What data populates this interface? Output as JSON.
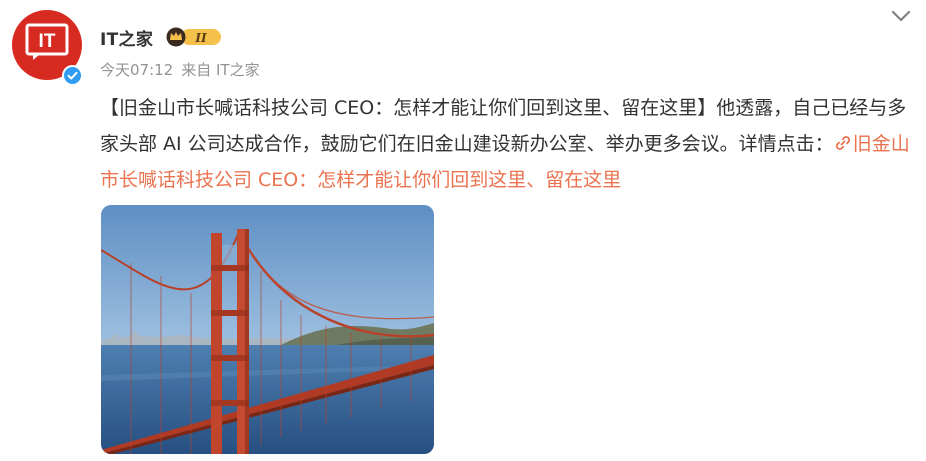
{
  "post": {
    "author": {
      "name": "IT之家",
      "avatar_text": "IT",
      "badge_text": "II"
    },
    "timestamp": "今天07:12",
    "source": "来自 IT之家",
    "text_intro": "【旧金山市长喊话科技公司 CEO：怎样才能让你们回到这里、留在这里】他透露，自己已经与多家头部 AI 公司达成合作，鼓励它们在旧金山建设新办公室、举办更多会议。详情点击：",
    "link_text": "旧金山市长喊话科技公司 CEO：怎样才能让你们回到这里、留在这里",
    "image": {
      "subject": "golden-gate-bridge-photo"
    }
  },
  "colors": {
    "brand_red": "#d72b21",
    "link_orange": "#eb7350",
    "verified_blue": "#2f9df4",
    "meta_gray": "#939393",
    "text": "#333333"
  },
  "icons": [
    "it-home-logo-icon",
    "verified-icon",
    "vip-crown-badge-icon",
    "chevron-down-icon",
    "link-icon"
  ]
}
